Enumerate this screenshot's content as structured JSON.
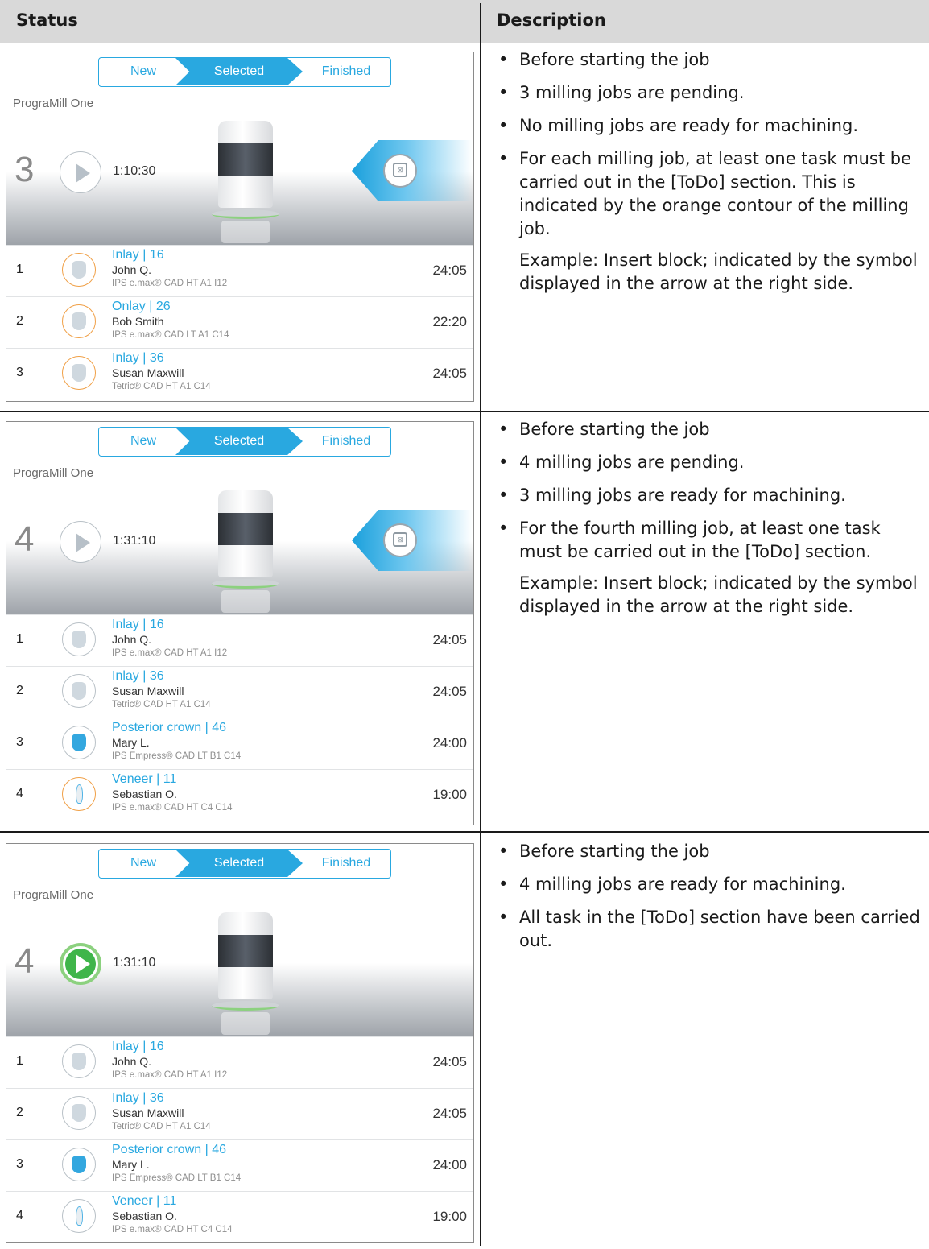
{
  "header": {
    "status": "Status",
    "description": "Description"
  },
  "rows": [
    {
      "screen": {
        "tabs": [
          "New",
          "Selected",
          "Finished"
        ],
        "device_name": "PrograMill One",
        "count": "3",
        "time": "1:10:30",
        "play_state": "disabled",
        "todo_arrow": true,
        "jobs": [
          {
            "index": "1",
            "title": "Inlay | 16",
            "patient": "John Q.",
            "material": "IPS e.max® CAD HT A1 I12",
            "duration": "24:05",
            "tooth": "inlay",
            "todo": true
          },
          {
            "index": "2",
            "title": "Onlay | 26",
            "patient": "Bob Smith",
            "material": "IPS e.max® CAD LT A1 C14",
            "duration": "22:20",
            "tooth": "inlay",
            "todo": true
          },
          {
            "index": "3",
            "title": "Inlay | 36",
            "patient": "Susan Maxwill",
            "material": "Tetric® CAD HT A1 C14",
            "duration": "24:05",
            "tooth": "inlay",
            "todo": true
          }
        ]
      },
      "description": {
        "bullets": [
          "Before starting the job",
          "3 milling jobs are pending.",
          "No milling jobs are ready for machining.",
          "For each milling job, at least one task must be carried out in the [ToDo] section. This is indicated by the orange contour of the milling job."
        ],
        "example": "Example: Insert block; indicated by the symbol displayed in the arrow at the right side."
      }
    },
    {
      "screen": {
        "tabs": [
          "New",
          "Selected",
          "Finished"
        ],
        "device_name": "PrograMill One",
        "count": "4",
        "time": "1:31:10",
        "play_state": "disabled",
        "todo_arrow": true,
        "jobs": [
          {
            "index": "1",
            "title": "Inlay | 16",
            "patient": "John Q.",
            "material": "IPS e.max® CAD HT A1 I12",
            "duration": "24:05",
            "tooth": "inlay",
            "todo": false
          },
          {
            "index": "2",
            "title": "Inlay | 36",
            "patient": "Susan Maxwill",
            "material": "Tetric® CAD HT A1 C14",
            "duration": "24:05",
            "tooth": "inlay",
            "todo": false
          },
          {
            "index": "3",
            "title": "Posterior crown | 46",
            "patient": "Mary L.",
            "material": "IPS Empress® CAD LT B1 C14",
            "duration": "24:00",
            "tooth": "crown",
            "todo": false
          },
          {
            "index": "4",
            "title": "Veneer | 11",
            "patient": "Sebastian O.",
            "material": "IPS e.max® CAD HT C4 C14",
            "duration": "19:00",
            "tooth": "veneer",
            "todo": true
          }
        ]
      },
      "description": {
        "bullets": [
          "Before starting the job",
          "4 milling jobs are pending.",
          "3 milling jobs are ready for machining.",
          "For the fourth milling job, at least one task must be carried out in the [ToDo] section."
        ],
        "example": "Example: Insert block; indicated by the symbol displayed in the arrow at the right side."
      }
    },
    {
      "screen": {
        "tabs": [
          "New",
          "Selected",
          "Finished"
        ],
        "device_name": "PrograMill One",
        "count": "4",
        "time": "1:31:10",
        "play_state": "active",
        "todo_arrow": false,
        "jobs": [
          {
            "index": "1",
            "title": "Inlay | 16",
            "patient": "John Q.",
            "material": "IPS e.max® CAD HT A1 I12",
            "duration": "24:05",
            "tooth": "inlay",
            "todo": false
          },
          {
            "index": "2",
            "title": "Inlay | 36",
            "patient": "Susan Maxwill",
            "material": "Tetric® CAD HT A1 C14",
            "duration": "24:05",
            "tooth": "inlay",
            "todo": false
          },
          {
            "index": "3",
            "title": "Posterior crown | 46",
            "patient": "Mary L.",
            "material": "IPS Empress® CAD LT B1 C14",
            "duration": "24:00",
            "tooth": "crown",
            "todo": false
          },
          {
            "index": "4",
            "title": "Veneer | 11",
            "patient": "Sebastian O.",
            "material": "IPS e.max® CAD HT C4 C14",
            "duration": "19:00",
            "tooth": "veneer",
            "todo": false
          }
        ]
      },
      "description": {
        "bullets": [
          "Before starting the job",
          "4 milling jobs are ready for machining.",
          "All task in the [ToDo] section have been carried out."
        ],
        "example": ""
      }
    }
  ],
  "colors": {
    "accent": "#29a8e0",
    "todo_orange": "#f0a047",
    "play_green": "#3fb54a"
  },
  "icons": {
    "play": "play-icon",
    "todo": "insert-block-icon",
    "tooth": "tooth-icon"
  }
}
